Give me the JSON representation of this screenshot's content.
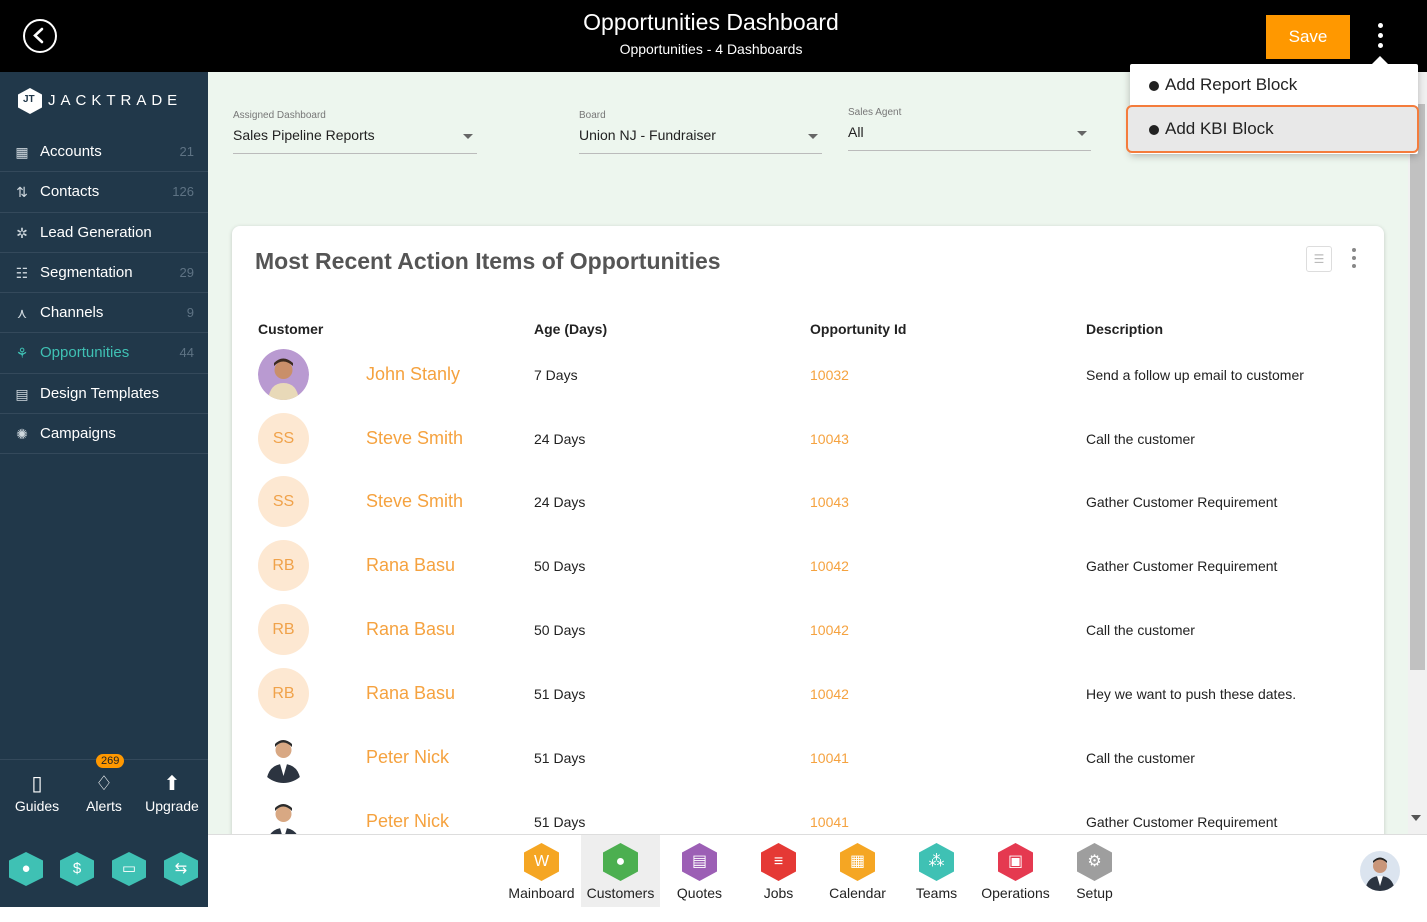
{
  "header": {
    "title": "Opportunities Dashboard",
    "subtitle": "Opportunities - 4 Dashboards",
    "save_label": "Save"
  },
  "dropdown": {
    "items": [
      {
        "label": "Add Report Block"
      },
      {
        "label": "Add KBI Block"
      }
    ],
    "highlight_color": "#f47c3c"
  },
  "sidebar": {
    "brand": "JACKTRADE",
    "brand_mark": "JT",
    "items": [
      {
        "label": "Accounts",
        "count": "21",
        "icon": "accounts-icon"
      },
      {
        "label": "Contacts",
        "count": "126",
        "icon": "contacts-icon"
      },
      {
        "label": "Lead Generation",
        "count": "",
        "icon": "lead-generation-icon"
      },
      {
        "label": "Segmentation",
        "count": "29",
        "icon": "segmentation-icon"
      },
      {
        "label": "Channels",
        "count": "9",
        "icon": "channels-icon"
      },
      {
        "label": "Opportunities",
        "count": "44",
        "icon": "opportunities-icon"
      },
      {
        "label": "Design Templates",
        "count": "",
        "icon": "design-templates-icon"
      },
      {
        "label": "Campaigns",
        "count": "",
        "icon": "campaigns-icon"
      }
    ],
    "bottom": {
      "guides": "Guides",
      "alerts": "Alerts",
      "alerts_count": "269",
      "upgrade": "Upgrade"
    },
    "accent_color": "#3fc1b4",
    "bg_color": "#21384a"
  },
  "filters": {
    "assigned_dashboard": {
      "label": "Assigned Dashboard",
      "value": "Sales Pipeline Reports"
    },
    "board": {
      "label": "Board",
      "value": "Union NJ - Fundraiser"
    },
    "sales_agent": {
      "label": "Sales Agent",
      "value": "All"
    }
  },
  "card": {
    "title": "Most Recent Action Items of Opportunities",
    "columns": [
      "Customer",
      "Age (Days)",
      "Opportunity Id",
      "Description"
    ],
    "rows": [
      {
        "initials": "",
        "photo": true,
        "customer": "John Stanly",
        "age": "7 Days",
        "id": "10032",
        "description": "Send a follow up email to customer"
      },
      {
        "initials": "SS",
        "photo": false,
        "customer": "Steve Smith",
        "age": "24 Days",
        "id": "10043",
        "description": "Call the customer"
      },
      {
        "initials": "SS",
        "photo": false,
        "customer": "Steve Smith",
        "age": "24 Days",
        "id": "10043",
        "description": "Gather Customer Requirement"
      },
      {
        "initials": "RB",
        "photo": false,
        "customer": "Rana Basu",
        "age": "50 Days",
        "id": "10042",
        "description": "Gather Customer Requirement"
      },
      {
        "initials": "RB",
        "photo": false,
        "customer": "Rana Basu",
        "age": "50 Days",
        "id": "10042",
        "description": "Call the customer"
      },
      {
        "initials": "RB",
        "photo": false,
        "customer": "Rana Basu",
        "age": "51 Days",
        "id": "10042",
        "description": "Hey we want to push these dates."
      },
      {
        "initials": "",
        "photo": true,
        "customer": "Peter Nick",
        "age": "51 Days",
        "id": "10041",
        "description": "Call the customer"
      },
      {
        "initials": "",
        "photo": true,
        "customer": "Peter Nick",
        "age": "51 Days",
        "id": "10041",
        "description": "Gather Customer Requirement"
      }
    ]
  },
  "bottombar": {
    "items": [
      {
        "label": "Mainboard",
        "color": "#f5a623",
        "icon": "mainboard-icon",
        "glyph": "W"
      },
      {
        "label": "Customers",
        "color": "#4caf50",
        "icon": "customers-icon",
        "glyph": "●"
      },
      {
        "label": "Quotes",
        "color": "#9c5fb5",
        "icon": "quotes-icon",
        "glyph": "▤"
      },
      {
        "label": "Jobs",
        "color": "#e53935",
        "icon": "jobs-icon",
        "glyph": "≡"
      },
      {
        "label": "Calendar",
        "color": "#f5a623",
        "icon": "calendar-icon",
        "glyph": "▦"
      },
      {
        "label": "Teams",
        "color": "#3fc1b4",
        "icon": "teams-icon",
        "glyph": "⁂"
      },
      {
        "label": "Operations",
        "color": "#e53950",
        "icon": "operations-icon",
        "glyph": "▣"
      },
      {
        "label": "Setup",
        "color": "#9e9e9e",
        "icon": "setup-icon",
        "glyph": "⚙"
      }
    ],
    "active": "Customers"
  },
  "accent_orange": "#ff9800"
}
